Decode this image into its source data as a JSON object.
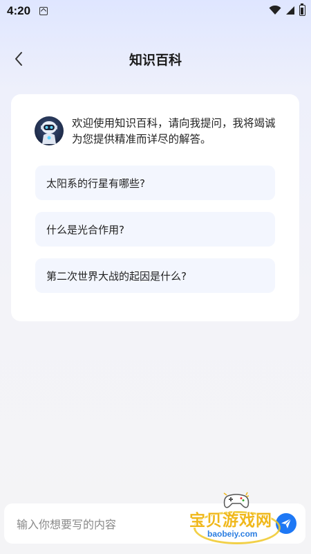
{
  "status_bar": {
    "time": "4:20"
  },
  "header": {
    "title": "知识百科",
    "back_icon": "chevron-left-icon"
  },
  "chat": {
    "avatar_icon": "robot-avatar-icon",
    "welcome_message": "欢迎使用知识百科，请向我提问，我将竭诚为您提供精准而详尽的解答。",
    "suggestions": [
      "太阳系的行星有哪些?",
      "什么是光合作用?",
      "第二次世界大战的起因是什么?"
    ]
  },
  "input": {
    "placeholder": "输入你想要写的内容",
    "value": "",
    "send_icon": "send-icon"
  },
  "watermark": {
    "text": "宝贝游戏网",
    "url": "baobeiy.com"
  },
  "colors": {
    "accent": "#1e78f5",
    "suggestion_bg": "#f3f6fe",
    "card_bg": "#ffffff",
    "watermark_gold": "#f0b81c",
    "watermark_blue": "#2a7de1"
  }
}
